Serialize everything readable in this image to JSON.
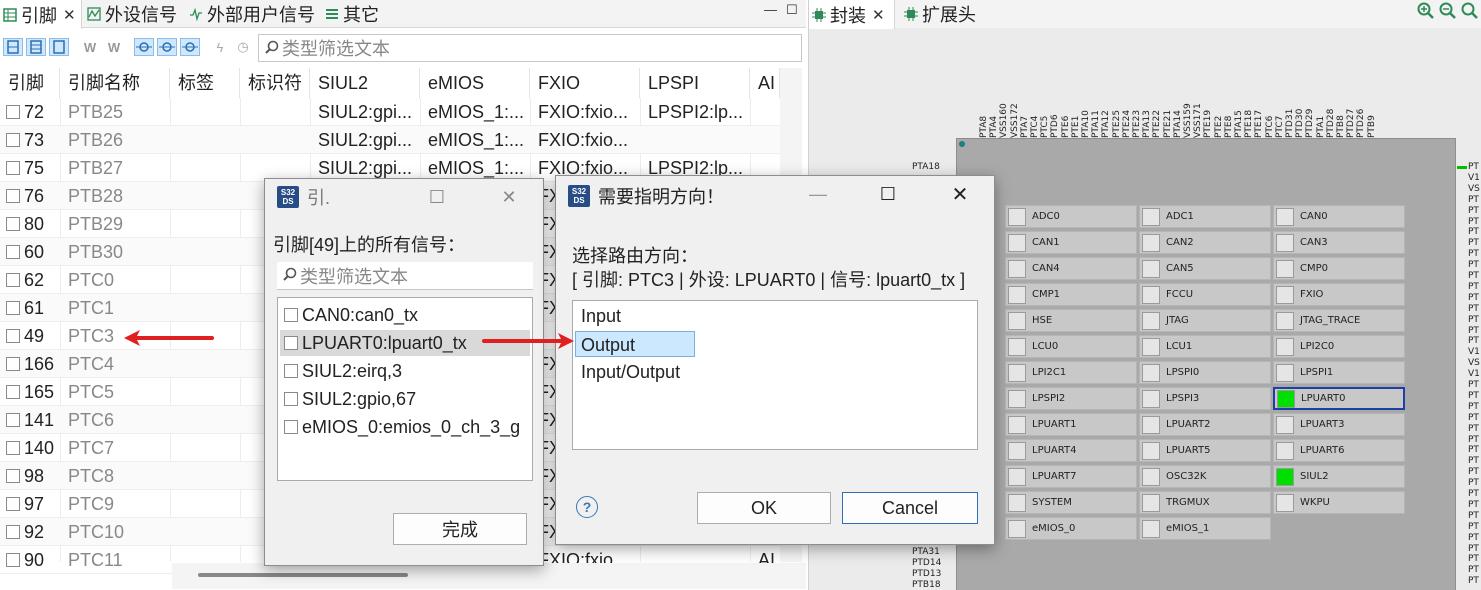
{
  "left_tabs": [
    {
      "label": "引脚",
      "icon": "table-icon",
      "active": true
    },
    {
      "label": "外设信号",
      "icon": "waveform-icon"
    },
    {
      "label": "外部用户信号",
      "icon": "signal-icon"
    },
    {
      "label": "其它",
      "icon": "list-icon"
    }
  ],
  "left_search_placeholder": "类型筛选文本",
  "table": {
    "columns": [
      "引脚",
      "引脚名称",
      "标签",
      "标识符",
      "SIUL2",
      "eMIOS",
      "FXIO",
      "LPSPI",
      "AI"
    ],
    "rows": [
      {
        "pin": "72",
        "name": "PTB25",
        "siul2": "SIUL2:gpi...",
        "emios": "eMIOS_1:...",
        "fxio": "FXIO:fxio...",
        "lpspi": "LPSPI2:lp..."
      },
      {
        "pin": "73",
        "name": "PTB26",
        "siul2": "SIUL2:gpi...",
        "emios": "eMIOS_1:...",
        "fxio": "FXIO:fxio...",
        "lpspi": ""
      },
      {
        "pin": "75",
        "name": "PTB27",
        "siul2": "SIUL2:gpi...",
        "emios": "eMIOS_1:...",
        "fxio": "FXIO:fxio...",
        "lpspi": "LPSPI2:lp..."
      },
      {
        "pin": "76",
        "name": "PTB28",
        "siul2": "",
        "emios": "",
        "fxio": "FX",
        "lpspi": ""
      },
      {
        "pin": "80",
        "name": "PTB29",
        "siul2": "",
        "emios": "",
        "fxio": "FX",
        "lpspi": ""
      },
      {
        "pin": "60",
        "name": "PTB30",
        "siul2": "",
        "emios": "",
        "fxio": "FX",
        "lpspi": ""
      },
      {
        "pin": "62",
        "name": "PTC0",
        "siul2": "",
        "emios": "",
        "fxio": "FX",
        "lpspi": ""
      },
      {
        "pin": "61",
        "name": "PTC1",
        "siul2": "",
        "emios": "",
        "fxio": "FX",
        "lpspi": ""
      },
      {
        "pin": "49",
        "name": "PTC3",
        "siul2": "",
        "emios": "",
        "fxio": "",
        "lpspi": ""
      },
      {
        "pin": "166",
        "name": "PTC4",
        "siul2": "",
        "emios": "",
        "fxio": "FX",
        "lpspi": ""
      },
      {
        "pin": "165",
        "name": "PTC5",
        "siul2": "",
        "emios": "",
        "fxio": "FX",
        "lpspi": ""
      },
      {
        "pin": "141",
        "name": "PTC6",
        "siul2": "",
        "emios": "",
        "fxio": "FX",
        "lpspi": ""
      },
      {
        "pin": "140",
        "name": "PTC7",
        "siul2": "",
        "emios": "",
        "fxio": "FX",
        "lpspi": ""
      },
      {
        "pin": "98",
        "name": "PTC8",
        "siul2": "",
        "emios": "",
        "fxio": "FX",
        "lpspi": ""
      },
      {
        "pin": "97",
        "name": "PTC9",
        "siul2": "",
        "emios": "",
        "fxio": "FX",
        "lpspi": ""
      },
      {
        "pin": "92",
        "name": "PTC10",
        "siul2": "",
        "emios": "",
        "fxio": "FX",
        "lpspi": ""
      },
      {
        "pin": "90",
        "name": "PTC11",
        "siul2": "",
        "emios": "",
        "fxio": "FXIO:fxio",
        "lpspi": "",
        "ai": "AI"
      }
    ]
  },
  "right_tabs": [
    {
      "label": "封装",
      "icon": "chip-icon",
      "active": true
    },
    {
      "label": "扩展头",
      "icon": "chip-icon"
    }
  ],
  "package": {
    "top_pins": [
      "PTA8",
      "PTA4",
      "VSS160",
      "VSS172",
      "PTA7",
      "PTC4",
      "PTC5",
      "PTD6",
      "PTE6",
      "PTE1",
      "PTA10",
      "PTA11",
      "PTA12",
      "PTE25",
      "PTE24",
      "PTE23",
      "PTA13",
      "PTE22",
      "PTE21",
      "PTA14",
      "VSS159",
      "VSS171",
      "PTE19",
      "PTE2",
      "PTE8",
      "PTA15",
      "PTE18",
      "PTE17",
      "PTC6",
      "PTC7",
      "PTD31",
      "PTD30",
      "PTD29",
      "PTA1",
      "PTD28",
      "PTB8",
      "PTD27",
      "PTD26",
      "PTB9"
    ],
    "left_pins_top": [
      "PTA18"
    ],
    "left_pins_bottom": [
      "PTA31",
      "PTD14",
      "PTD13",
      "PTB18"
    ],
    "right_pins": [
      "PT",
      "V1",
      "VS",
      "PT",
      "PT",
      "PT",
      "PT",
      "PT",
      "PT",
      "PT",
      "PT",
      "PT",
      "PT",
      "PT",
      "PT",
      "PT",
      "PT",
      "V1",
      "VS",
      "V1",
      "PT",
      "PT",
      "PT",
      "PT",
      "PT",
      "PT",
      "PT",
      "PT",
      "PT",
      "PT",
      "PT",
      "PT",
      "PT",
      "PT",
      "PT",
      "PT",
      "PT",
      "PT",
      "PT"
    ],
    "peripherals": [
      {
        "name": "ADC0",
        "on": false
      },
      {
        "name": "ADC1",
        "on": false
      },
      {
        "name": "CAN0",
        "on": false
      },
      {
        "name": "CAN1",
        "on": false
      },
      {
        "name": "CAN2",
        "on": false
      },
      {
        "name": "CAN3",
        "on": false
      },
      {
        "name": "CAN4",
        "on": false
      },
      {
        "name": "CAN5",
        "on": false
      },
      {
        "name": "CMP0",
        "on": false
      },
      {
        "name": "CMP1",
        "on": false
      },
      {
        "name": "FCCU",
        "on": false
      },
      {
        "name": "FXIO",
        "on": false
      },
      {
        "name": "HSE",
        "on": false
      },
      {
        "name": "JTAG",
        "on": false
      },
      {
        "name": "JTAG_TRACE",
        "on": false
      },
      {
        "name": "LCU0",
        "on": false
      },
      {
        "name": "LCU1",
        "on": false
      },
      {
        "name": "LPI2C0",
        "on": false
      },
      {
        "name": "LPI2C1",
        "on": false
      },
      {
        "name": "LPSPI0",
        "on": false
      },
      {
        "name": "LPSPI1",
        "on": false
      },
      {
        "name": "LPSPI2",
        "on": false
      },
      {
        "name": "LPSPI3",
        "on": false
      },
      {
        "name": "LPUART0",
        "on": true,
        "selected": true
      },
      {
        "name": "LPUART1",
        "on": false
      },
      {
        "name": "LPUART2",
        "on": false
      },
      {
        "name": "LPUART3",
        "on": false
      },
      {
        "name": "LPUART4",
        "on": false
      },
      {
        "name": "LPUART5",
        "on": false
      },
      {
        "name": "LPUART6",
        "on": false
      },
      {
        "name": "LPUART7",
        "on": false
      },
      {
        "name": "OSC32K",
        "on": false
      },
      {
        "name": "SIUL2",
        "on": true
      },
      {
        "name": "SYSTEM",
        "on": false
      },
      {
        "name": "TRGMUX",
        "on": false
      },
      {
        "name": "WKPU",
        "on": false
      },
      {
        "name": "eMIOS_0",
        "on": false
      },
      {
        "name": "eMIOS_1",
        "on": false
      }
    ]
  },
  "signals_dialog": {
    "title": "引.",
    "prompt": "引脚[49]上的所有信号：",
    "filter_placeholder": "类型筛选文本",
    "signals": [
      "CAN0:can0_tx",
      "LPUART0:lpuart0_tx",
      "SIUL2:eirq,3",
      "SIUL2:gpio,67",
      "eMIOS_0:emios_0_ch_3_g"
    ],
    "selected_index": 1,
    "done_label": "完成"
  },
  "direction_dialog": {
    "title": "需要指明方向！",
    "prompt": "选择路由方向：",
    "detail": "[ 引脚:  PTC3 | 外设: LPUART0 | 信号: lpuart0_tx ]",
    "options": [
      "Input",
      "Output",
      "Input/Output"
    ],
    "selected_index": 1,
    "ok_label": "OK",
    "cancel_label": "Cancel"
  },
  "colors": {
    "arrow": "#e02020",
    "enabled": "#00e000",
    "selection": "#cce8ff"
  }
}
